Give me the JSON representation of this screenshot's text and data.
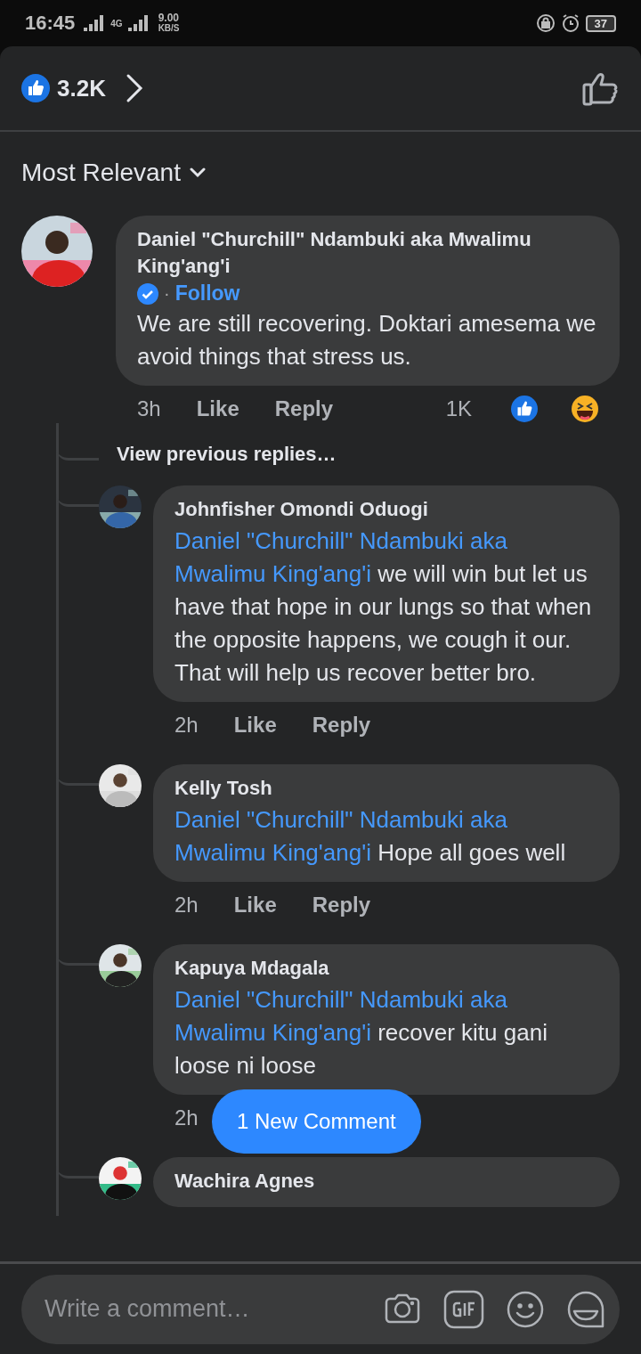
{
  "status_bar": {
    "time": "16:45",
    "network": "4G",
    "speed": "9.00",
    "speed_unit": "KB/S",
    "battery": "37"
  },
  "header": {
    "reaction_count": "3.2K"
  },
  "sort": {
    "label": "Most Relevant"
  },
  "comment": {
    "author": "Daniel \"Churchill\" Ndambuki aka Mwalimu King'ang'i",
    "verified": true,
    "separator": "·",
    "follow": "Follow",
    "text": "We are still recovering. Doktari amesema we avoid things that stress us.",
    "time": "3h",
    "actions": [
      "Like",
      "Reply"
    ],
    "reaction_count": "1K"
  },
  "view_previous": "View previous replies…",
  "replies": [
    {
      "author": "Johnfisher Omondi Oduogi",
      "mention": "Daniel \"Churchill\" Ndambuki aka Mwalimu King'ang'i",
      "text": "we will win but let us have that hope in our lungs so that when the opposite happens, we cough it our. That will help us recover better bro.",
      "time": "2h",
      "actions": [
        "Like",
        "Reply"
      ]
    },
    {
      "author": "Kelly Tosh",
      "mention": "Daniel \"Churchill\" Ndambuki aka Mwalimu King'ang'i",
      "text": "Hope all goes well",
      "time": "2h",
      "actions": [
        "Like",
        "Reply"
      ]
    },
    {
      "author": "Kapuya Mdagala",
      "mention": "Daniel \"Churchill\" Ndambuki aka Mwalimu King'ang'i",
      "text": "recover kitu gani loose ni loose",
      "time": "2h"
    },
    {
      "author": "Wachira Agnes"
    }
  ],
  "new_comment_button": "1 New Comment",
  "composer": {
    "placeholder": "Write a comment…"
  }
}
